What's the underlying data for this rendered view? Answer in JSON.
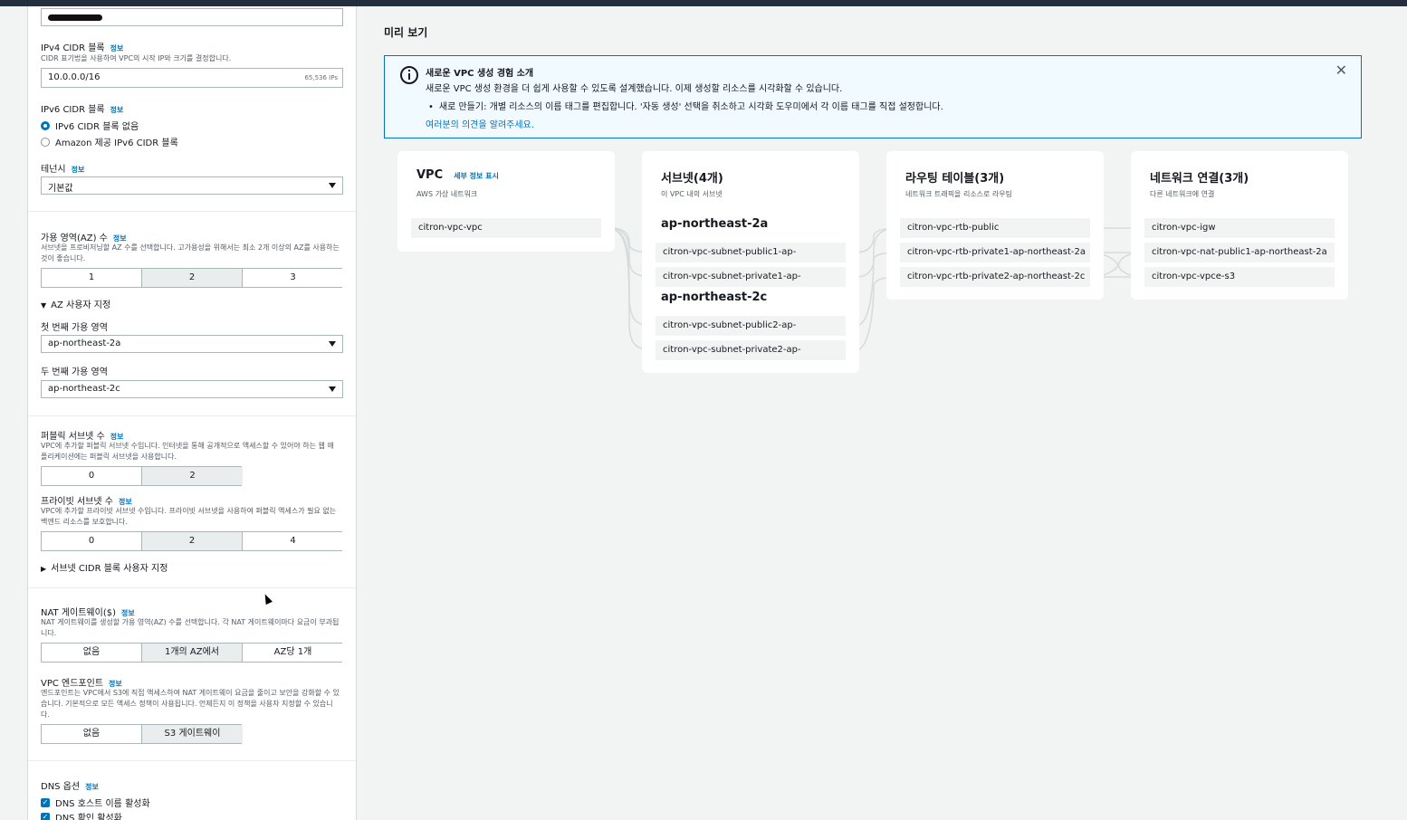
{
  "left": {
    "name_value": "",
    "ipv4": {
      "label": "IPv4 CIDR 블록",
      "info": "정보",
      "desc": "CIDR 표기법을 사용하여 VPC의 시작 IP와 크기를 결정합니다.",
      "value": "10.0.0.0/16",
      "count": "65,536 IPs"
    },
    "ipv6": {
      "label": "IPv6 CIDR 블록",
      "info": "정보",
      "opt1": "IPv6 CIDR 블록 없음",
      "opt2": "Amazon 제공 IPv6 CIDR 블록"
    },
    "tenancy": {
      "label": "테넌시",
      "info": "정보",
      "value": "기본값"
    },
    "az_count": {
      "label": "가용 영역(AZ) 수",
      "info": "정보",
      "desc": "서브넷을 프로비저닝할 AZ 수를 선택합니다. 고가용성을 위해서는 최소 2개 이상의 AZ를 사용하는 것이 좋습니다.",
      "options": [
        "1",
        "2",
        "3"
      ]
    },
    "az_custom": {
      "label": "AZ 사용자 지정",
      "first_label": "첫 번째 가용 영역",
      "first_value": "ap-northeast-2a",
      "second_label": "두 번째 가용 영역",
      "second_value": "ap-northeast-2c"
    },
    "public_subnets": {
      "label": "퍼블릭 서브넷 수",
      "info": "정보",
      "desc": "VPC에 추가할 퍼블릭 서브넷 수입니다. 인터넷을 통해 공개적으로 액세스할 수 있어야 하는 웹 애플리케이션에는 퍼블릭 서브넷을 사용합니다.",
      "options": [
        "0",
        "2"
      ]
    },
    "private_subnets": {
      "label": "프라이빗 서브넷 수",
      "info": "정보",
      "desc": "VPC에 추가할 프라이빗 서브넷 수입니다. 프라이빗 서브넷을 사용하여 퍼블릭 액세스가 필요 없는 백엔드 리소스를 보호합니다.",
      "options": [
        "0",
        "2",
        "4"
      ]
    },
    "subnet_cidr": {
      "label": "서브넷 CIDR 블록 사용자 지정"
    },
    "nat": {
      "label": "NAT 게이트웨이($)",
      "info": "정보",
      "desc": "NAT 게이트웨이를 생성할 가용 영역(AZ) 수를 선택합니다. 각 NAT 게이트웨이마다 요금이 부과됩니다.",
      "options": [
        "없음",
        "1개의 AZ에서",
        "AZ당 1개"
      ]
    },
    "endpoint": {
      "label": "VPC 엔드포인트",
      "info": "정보",
      "desc": "엔드포인트는 VPC에서 S3에 직접 액세스하여 NAT 게이트웨이 요금을 줄이고 보안을 강화할 수 있습니다. 기본적으로 모든 액세스 정책이 사용됩니다. 언제든지 이 정책을 사용자 지정할 수 있습니다.",
      "options": [
        "없음",
        "S3 게이트웨이"
      ]
    },
    "dns": {
      "label": "DNS 옵션",
      "info": "정보",
      "opt1": "DNS 호스트 이름 활성화",
      "opt2": "DNS 확인 활성화"
    }
  },
  "preview": {
    "title": "미리 보기",
    "banner": {
      "title": "새로운 VPC 생성 경험 소개",
      "line1": "새로운 VPC 생성 환경을 더 쉽게 사용할 수 있도록 설계했습니다. 이제 생성할 리소스를 시각화할 수 있습니다.",
      "bullet": "새로 만들기: 개별 리소스의 이름 태그를 편집합니다. '자동 생성' 선택을 취소하고 시각화 도우미에서 각 이름 태그를 직접 설정합니다.",
      "link": "여러분의 의견을 알려주세요."
    },
    "vpc": {
      "title": "VPC",
      "detail_link": "세부 정보 표시",
      "sub": "AWS 가상 네트워크",
      "items": [
        "citron-vpc-vpc"
      ]
    },
    "subnets": {
      "title": "서브넷(4개)",
      "sub": "이 VPC 내의 서브넷",
      "az1": "ap-northeast-2a",
      "az1_items": [
        "citron-vpc-subnet-public1-ap-",
        "citron-vpc-subnet-private1-ap-"
      ],
      "az2": "ap-northeast-2c",
      "az2_items": [
        "citron-vpc-subnet-public2-ap-",
        "citron-vpc-subnet-private2-ap-"
      ]
    },
    "routes": {
      "title": "라우팅 테이블(3개)",
      "sub": "네트워크 트래픽을 리소스로 라우팅",
      "items": [
        "citron-vpc-rtb-public",
        "citron-vpc-rtb-private1-ap-northeast-2a",
        "citron-vpc-rtb-private2-ap-northeast-2c"
      ]
    },
    "network": {
      "title": "네트워크 연결(3개)",
      "sub": "다른 네트워크에 연결",
      "items": [
        "citron-vpc-igw",
        "citron-vpc-nat-public1-ap-northeast-2a",
        "citron-vpc-vpce-s3"
      ]
    }
  },
  "colors": {
    "accent": "#0073bb",
    "banner_bg": "#f1faff",
    "topbar": "#232f3e"
  }
}
